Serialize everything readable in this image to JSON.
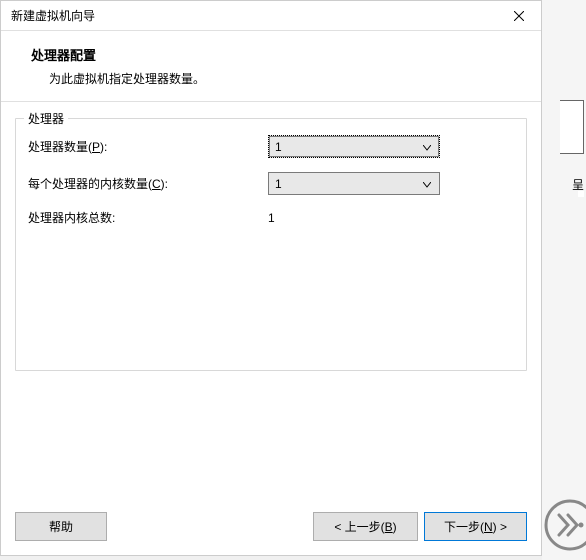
{
  "dialog": {
    "title": "新建虚拟机向导",
    "header_title": "处理器配置",
    "header_sub": "为此虚拟机指定处理器数量。"
  },
  "fieldset": {
    "legend": "处理器",
    "rows": {
      "proc_count_label_pre": "处理器数量(",
      "proc_count_label_key": "P",
      "proc_count_label_post": "):",
      "proc_count_value": "1",
      "cores_label_pre": "每个处理器的内核数量(",
      "cores_label_key": "C",
      "cores_label_post": "):",
      "cores_value": "1",
      "total_label": "处理器内核总数:",
      "total_value": "1"
    }
  },
  "footer": {
    "help": "帮助",
    "back_pre": "< 上一步(",
    "back_key": "B",
    "back_post": ")",
    "next_pre": "下一步(",
    "next_key": "N",
    "next_post": ") >"
  },
  "side": {
    "frag": "呈"
  }
}
